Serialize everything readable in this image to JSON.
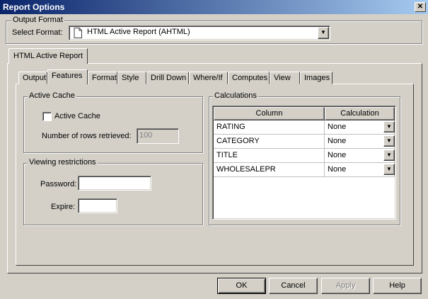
{
  "window": {
    "title": "Report Options",
    "close_glyph": "✕"
  },
  "output_format": {
    "group_label": "Output Format",
    "select_label": "Select Format:",
    "selected_value": "HTML Active Report (AHTML)"
  },
  "outer_tab": {
    "label": "HTML Active Report"
  },
  "tabs": [
    {
      "label": "Output"
    },
    {
      "label": "Features"
    },
    {
      "label": "Format"
    },
    {
      "label": "Style"
    },
    {
      "label": "Drill Down"
    },
    {
      "label": "Where/If"
    },
    {
      "label": "Computes"
    },
    {
      "label": "View"
    },
    {
      "label": "Images"
    }
  ],
  "active_cache": {
    "group_label": "Active Cache",
    "checkbox_label": "Active Cache",
    "checked": false,
    "rows_label": "Number of rows retrieved:",
    "rows_value": "100"
  },
  "viewing": {
    "group_label": "Viewing restrictions",
    "password_label": "Password:",
    "password_value": "",
    "expire_label": "Expire:",
    "expire_value": ""
  },
  "calculations": {
    "group_label": "Calculations",
    "headers": [
      "Column",
      "Calculation"
    ],
    "rows": [
      {
        "column": "RATING",
        "calc": "None"
      },
      {
        "column": "CATEGORY",
        "calc": "None"
      },
      {
        "column": "TITLE",
        "calc": "None"
      },
      {
        "column": "WHOLESALEPR",
        "calc": "None"
      }
    ]
  },
  "buttons": {
    "ok": "OK",
    "cancel": "Cancel",
    "apply": "Apply",
    "help": "Help"
  },
  "icons": {
    "document": "document-icon",
    "dropdown": "chevron-down-icon",
    "close": "close-icon"
  }
}
